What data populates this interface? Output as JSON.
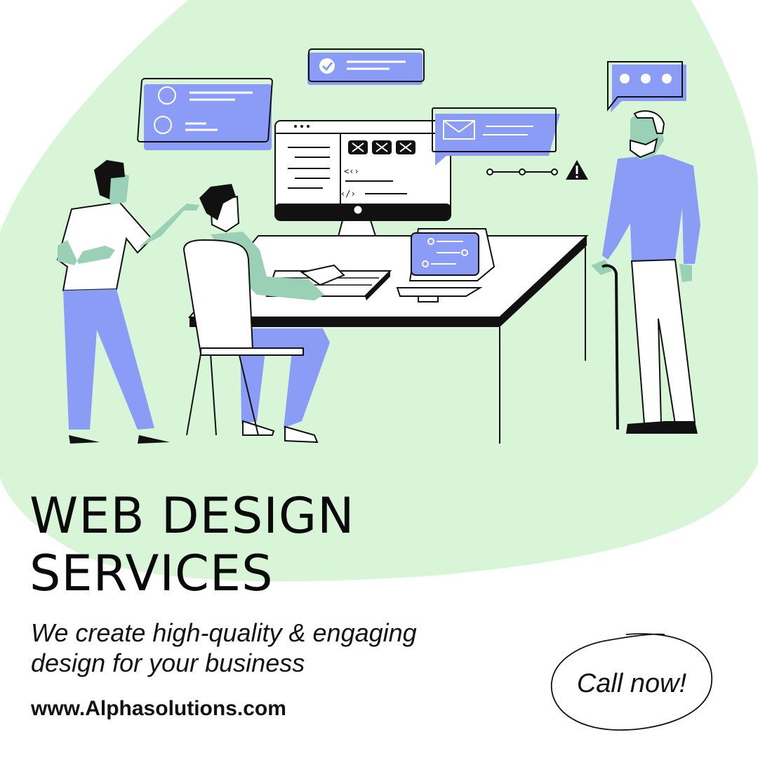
{
  "headline": {
    "line1": "WEB DESIGN",
    "line2": "SERVICES"
  },
  "subtitle": {
    "line1": "We create high-quality & engaging",
    "line2": "design for your business"
  },
  "website": "www.Alphasolutions.com",
  "cta": {
    "label": "Call now!"
  },
  "colors": {
    "background": "#ffffff",
    "blob": "#d8f5d8",
    "accent_blue": "#8a9cf5",
    "accent_green": "#9ad0b6",
    "ink": "#0a0a0a"
  },
  "illustration": {
    "icons": [
      "check-icon",
      "mail-icon",
      "warning-icon",
      "chat-bubble-icon",
      "code-icon"
    ]
  }
}
